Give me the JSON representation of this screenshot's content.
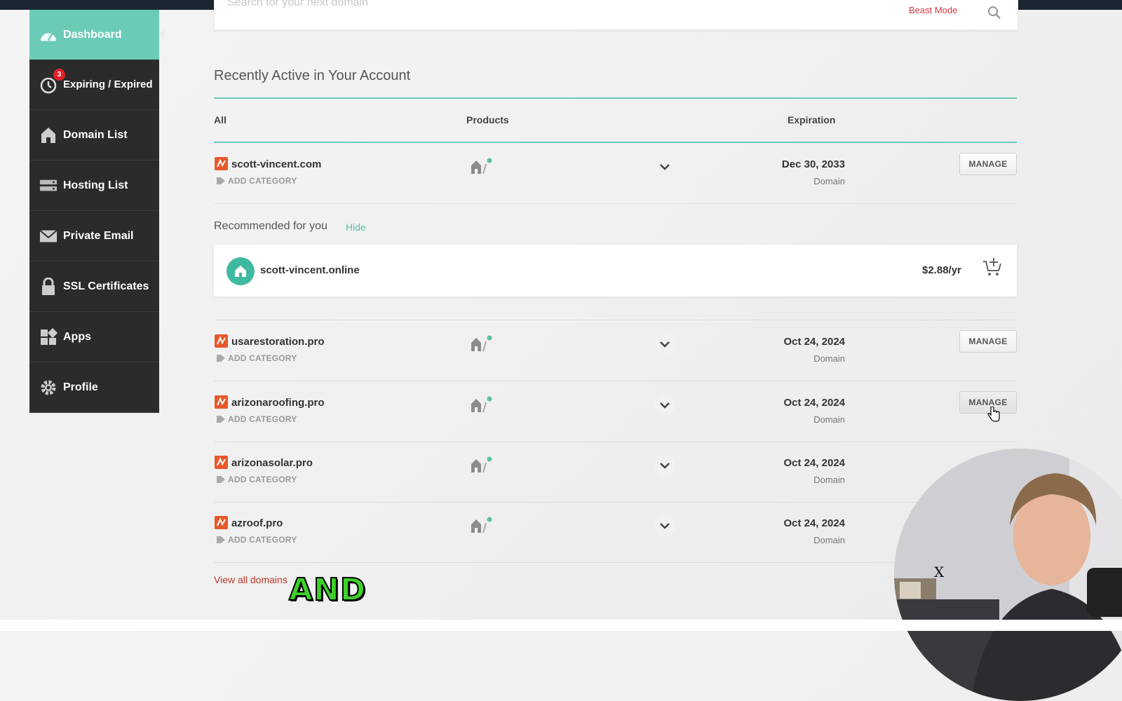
{
  "search": {
    "placeholder": "Search for your next domain",
    "beast_mode_label": "Beast Mode"
  },
  "sidebar": {
    "items": [
      {
        "label": "Dashboard",
        "icon": "dashboard-gauge-icon",
        "active": true
      },
      {
        "label": "Expiring / Expired",
        "icon": "stopwatch-icon",
        "badge": "3"
      },
      {
        "label": "Domain List",
        "icon": "house-icon"
      },
      {
        "label": "Hosting List",
        "icon": "server-icon"
      },
      {
        "label": "Private Email",
        "icon": "envelope-icon"
      },
      {
        "label": "SSL Certificates",
        "icon": "lock-icon"
      },
      {
        "label": "Apps",
        "icon": "apps-grid-icon"
      },
      {
        "label": "Profile",
        "icon": "gear-icon"
      }
    ]
  },
  "main": {
    "section_title": "Recently Active in Your Account",
    "columns": {
      "all": "All",
      "products": "Products",
      "expiration": "Expiration"
    },
    "add_category_label": "ADD CATEGORY",
    "manage_label": "MANAGE",
    "domains": [
      {
        "name": "scott-vincent.com",
        "expiration": "Dec 30, 2033",
        "type": "Domain"
      },
      {
        "name": "usarestoration.pro",
        "expiration": "Oct 24, 2024",
        "type": "Domain"
      },
      {
        "name": "arizonaroofing.pro",
        "expiration": "Oct 24, 2024",
        "type": "Domain"
      },
      {
        "name": "arizonasolar.pro",
        "expiration": "Oct 24, 2024",
        "type": "Domain"
      },
      {
        "name": "azroof.pro",
        "expiration": "Oct 24, 2024",
        "type": "Domain"
      }
    ],
    "recommended": {
      "label": "Recommended for you",
      "hide_label": "Hide",
      "domain": "scott-vincent.online",
      "price": "$2.88/yr"
    },
    "view_all_label": "View all domains"
  },
  "overlay": {
    "caption": "AND",
    "webcam_close": "X"
  },
  "colors": {
    "accent_teal": "#6ccbb7",
    "sidebar_dark": "#2b2b2b",
    "namecheap_orange": "#e9582a",
    "link_red": "#c0392b",
    "badge_red": "#e22027",
    "caption_green": "#3ed12a"
  }
}
